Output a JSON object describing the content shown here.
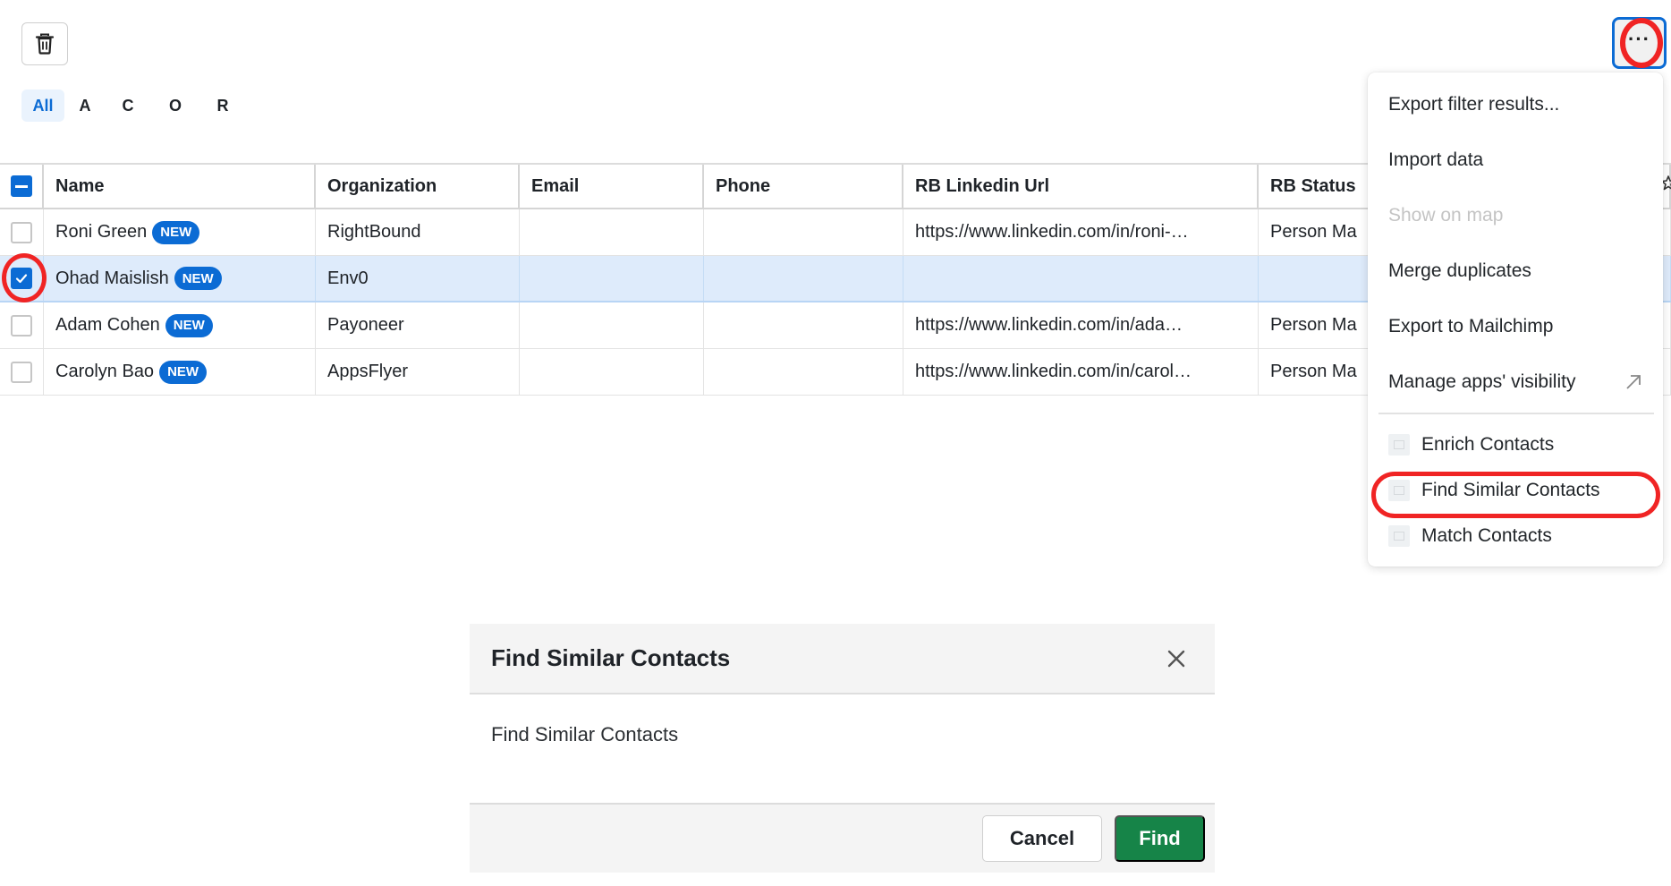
{
  "toolbar": {
    "delete_icon": "trash-icon",
    "more_icon": "ellipsis-icon",
    "more_label": "···"
  },
  "alphabet_filter": {
    "tabs": [
      {
        "label": "All",
        "active": true
      },
      {
        "label": "A",
        "active": false
      },
      {
        "label": "C",
        "active": false
      },
      {
        "label": "O",
        "active": false
      },
      {
        "label": "R",
        "active": false
      }
    ]
  },
  "table": {
    "select_all_state": "partial",
    "columns": [
      "Name",
      "Organization",
      "Email",
      "Phone",
      "RB Linkedin Url",
      "RB Status"
    ],
    "rows": [
      {
        "name": "Roni Green",
        "badge": "NEW",
        "organization": "RightBound",
        "email": "",
        "phone": "",
        "linkedin": "https://www.linkedin.com/in/roni-…",
        "status": "Person Ma",
        "checked": false
      },
      {
        "name": "Ohad Maislish",
        "badge": "NEW",
        "organization": "Env0",
        "email": "",
        "phone": "",
        "linkedin": "",
        "status": "",
        "checked": true
      },
      {
        "name": "Adam Cohen",
        "badge": "NEW",
        "organization": "Payoneer",
        "email": "",
        "phone": "",
        "linkedin": "https://www.linkedin.com/in/ada…",
        "status": "Person Ma",
        "checked": false
      },
      {
        "name": "Carolyn Bao",
        "badge": "NEW",
        "organization": "AppsFlyer",
        "email": "",
        "phone": "",
        "linkedin": "https://www.linkedin.com/in/carol…",
        "status": "Person Ma",
        "checked": false
      }
    ]
  },
  "menu": {
    "items": [
      {
        "label": "Export filter results...",
        "disabled": false
      },
      {
        "label": "Import data",
        "disabled": false
      },
      {
        "label": "Show on map",
        "disabled": true
      },
      {
        "label": "Merge duplicates",
        "disabled": false
      },
      {
        "label": "Export to Mailchimp",
        "disabled": false
      },
      {
        "label": "Manage apps' visibility",
        "disabled": false,
        "icon": "external-arrow-icon"
      }
    ],
    "apps": [
      {
        "label": "Enrich Contacts"
      },
      {
        "label": "Find Similar Contacts",
        "highlighted": true
      },
      {
        "label": "Match Contacts"
      }
    ]
  },
  "dialog": {
    "title": "Find Similar Contacts",
    "body": "Find Similar Contacts",
    "cancel_label": "Cancel",
    "confirm_label": "Find"
  },
  "colors": {
    "accent": "#0b6bd4",
    "selected_row": "#deebfb",
    "confirm_button": "#168448",
    "annotation": "#f02424"
  }
}
